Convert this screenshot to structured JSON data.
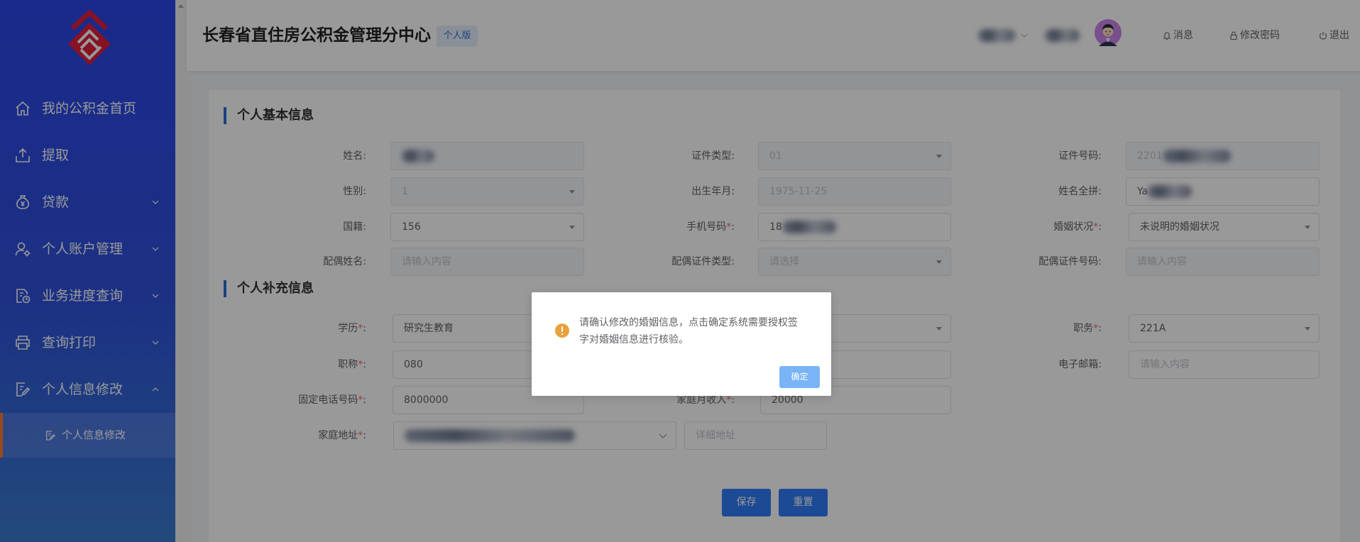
{
  "app": {
    "title": "长春省直住房公积金管理分中心",
    "badge": "个人版",
    "logo_icon": "housing-fund-logo-icon"
  },
  "header": {
    "messages": "消息",
    "messages_icon": "bell-icon",
    "change_password": "修改密码",
    "change_password_icon": "lock-icon",
    "logout": "退出",
    "logout_icon": "power-icon"
  },
  "sidebar": {
    "items": [
      {
        "label": "我的公积金首页",
        "icon": "home-icon"
      },
      {
        "label": "提取",
        "icon": "upload-icon"
      },
      {
        "label": "贷款",
        "icon": "money-bag-icon",
        "chevron_icon": "chevron-down-icon"
      },
      {
        "label": "个人账户管理",
        "icon": "user-gear-icon",
        "chevron_icon": "chevron-down-icon"
      },
      {
        "label": "业务进度查询",
        "icon": "progress-query-icon",
        "chevron_icon": "chevron-down-icon"
      },
      {
        "label": "查询打印",
        "icon": "printer-icon",
        "chevron_icon": "chevron-down-icon"
      },
      {
        "label": "个人信息修改",
        "icon": "edit-profile-icon",
        "chevron_icon": "chevron-up-icon",
        "expanded": true
      }
    ],
    "subitems": [
      {
        "label": "个人信息修改",
        "icon": "edit-profile-icon",
        "active": true
      }
    ]
  },
  "form": {
    "required_mark": "*",
    "colon": ":"
  },
  "basic_info": {
    "title": "个人基本信息",
    "fields": {
      "name": {
        "label": "姓名"
      },
      "id_type": {
        "label": "证件类型",
        "value": "01"
      },
      "id_number": {
        "label": "证件号码",
        "value": "2201"
      },
      "gender": {
        "label": "性别",
        "value": "1"
      },
      "birth": {
        "label": "出生年月",
        "value": "1975-11-25"
      },
      "name_pinyin": {
        "label": "姓名全拼",
        "value": "Ya"
      },
      "nationality": {
        "label": "国籍",
        "value": "156"
      },
      "mobile": {
        "label": "手机号码",
        "value": "18",
        "required": true
      },
      "marital_status": {
        "label": "婚姻状况",
        "value": "未说明的婚姻状况",
        "required": true
      },
      "spouse_name": {
        "label": "配偶姓名",
        "placeholder": "请输入内容"
      },
      "spouse_id_type": {
        "label": "配偶证件类型",
        "placeholder": "请选择"
      },
      "spouse_id_number": {
        "label": "配偶证件号码",
        "placeholder": "请输入内容"
      }
    }
  },
  "supplementary_info": {
    "title": "个人补充信息",
    "fields": {
      "education": {
        "label": "学历",
        "value": "研究生教育",
        "required": true
      },
      "position": {
        "label": "职务",
        "value": "221A",
        "required": true
      },
      "professional_title": {
        "label": "职称",
        "value": "080",
        "required": true
      },
      "email": {
        "label": "电子邮箱",
        "placeholder": "请输入内容"
      },
      "landline": {
        "label": "固定电话号码",
        "value": "8000000",
        "required": true
      },
      "family_income": {
        "label": "家庭月收入",
        "value": "20000",
        "required": true
      },
      "address": {
        "label": "家庭地址",
        "required": true,
        "detail_placeholder": "详细地址"
      }
    }
  },
  "actions": {
    "save": "保存",
    "reset": "重置"
  },
  "modal": {
    "icon": "warning-icon",
    "message": "请确认修改的婚姻信息，点击确定系统需要授权签字对婚姻信息进行核验。",
    "confirm": "确定"
  },
  "colors": {
    "primary": "#2f7cf8",
    "sidebar_top": "#2b46e9",
    "sidebar_bottom": "#3a7bcf",
    "active_indicator": "#ff7a2e",
    "warning": "#e6a23c",
    "required": "#f56c6c",
    "confirm_button": "#79b4f6"
  }
}
